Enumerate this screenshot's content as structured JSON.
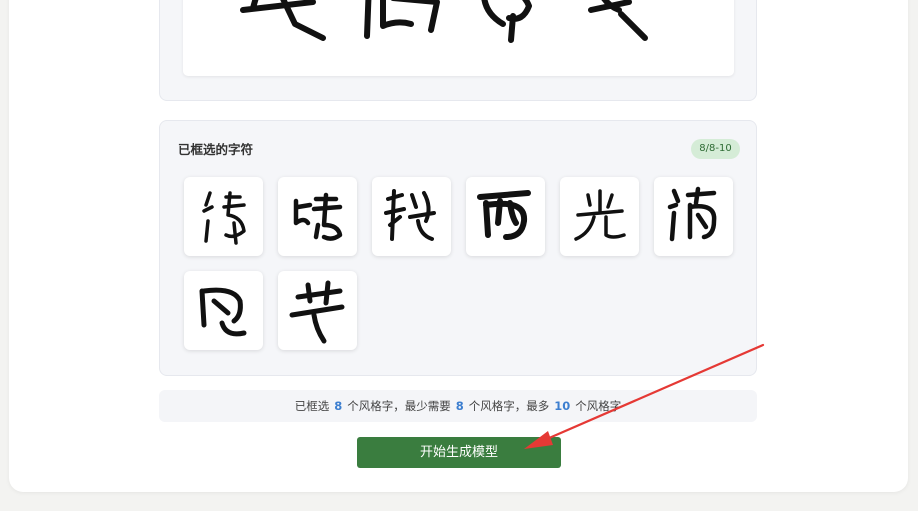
{
  "selected_panel": {
    "title": "已框选的字符",
    "badge": "8/8-10"
  },
  "glyphs": [
    {
      "name": "glyph-qing"
    },
    {
      "name": "glyph-qing2"
    },
    {
      "name": "glyph-qiu"
    },
    {
      "name": "glyph-xi"
    },
    {
      "name": "glyph-guang"
    },
    {
      "name": "glyph-man"
    },
    {
      "name": "glyph-feng"
    },
    {
      "name": "glyph-ye"
    }
  ],
  "info": {
    "p1": "已框选",
    "selected": "8",
    "p2": "个风格字，最少需要",
    "min": "8",
    "p3": "个风格字，最多",
    "max": "10",
    "p4": "个风格字"
  },
  "actions": {
    "start_label": "开始生成模型"
  },
  "colors": {
    "accent_green": "#3a7d3f",
    "badge_bg": "#d5ecd7",
    "badge_text": "#2e6b34",
    "number_blue": "#3d7fd0",
    "annotation_red": "#e53935"
  }
}
